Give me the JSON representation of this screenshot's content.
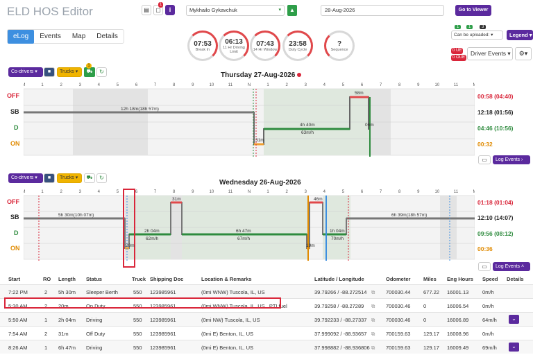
{
  "app": {
    "title": "ELD HOS Editor"
  },
  "header": {
    "driver": "Mykhailo Gykavchuk",
    "date": "28-Aug-2026",
    "go_viewer": "Go to Viewer",
    "doc_badge": "1"
  },
  "tabs": [
    "eLog",
    "Events",
    "Map",
    "Details"
  ],
  "gauges": [
    {
      "time": "07:53",
      "label": "Break In"
    },
    {
      "time": "06:13",
      "label": "11 Hr Driving Limit"
    },
    {
      "time": "07:43",
      "label": "14 Hr Window"
    },
    {
      "time": "23:58",
      "label": "Duty Cycle"
    },
    {
      "time": "?",
      "label": "Sequence"
    }
  ],
  "right_panel": {
    "count_badges": [
      "1",
      "1",
      "3"
    ],
    "can_be_uploaded": "Can be uploaded:",
    "legend": "Legend",
    "ue": "0 UE",
    "oue": "0 OUE",
    "driver_events": "Driver Events"
  },
  "log1": {
    "date": "Thursday 27-Aug-2026",
    "codrivers": "Co-drivers",
    "trucks": "Trucks",
    "truck_badge": "1",
    "hours": [
      "M",
      "1",
      "2",
      "3",
      "4",
      "5",
      "6",
      "7",
      "8",
      "9",
      "10",
      "11",
      "N",
      "1",
      "2",
      "3",
      "4",
      "5",
      "6",
      "7",
      "8",
      "9",
      "10",
      "11",
      "M"
    ],
    "row_labels": [
      "OFF",
      "SB",
      "D",
      "ON"
    ],
    "totals": [
      "00:58 (04:40)",
      "12:18 (01:56)",
      "04:46 (10:56)",
      "00:32"
    ],
    "seg_labels": [
      "12h 18m(18h 57m)",
      "58m",
      "4h 40m",
      "63m/h",
      "06m",
      "31m"
    ],
    "log_events": "Log Events"
  },
  "log2": {
    "date": "Wednesday 26-Aug-2026",
    "codrivers": "Co-drivers",
    "trucks": "Trucks",
    "hours": [
      "M",
      "1",
      "2",
      "3",
      "4",
      "5",
      "6",
      "7",
      "8",
      "9",
      "10",
      "11",
      "N",
      "1",
      "2",
      "3",
      "4",
      "5",
      "6",
      "7",
      "8",
      "9",
      "10",
      "11",
      "M"
    ],
    "row_labels": [
      "OFF",
      "SB",
      "D",
      "ON"
    ],
    "totals": [
      "01:18 (01:04)",
      "12:10 (14:07)",
      "09:56 (08:12)",
      "00:36"
    ],
    "seg_labels": [
      "5h 30m(10h 07m)",
      "31m",
      "2h 04m",
      "62m/h",
      "6h 47m",
      "67m/h",
      "46m",
      "1h 04m",
      "70m/h",
      "6h 39m(18h 57m)",
      "20m",
      "19m"
    ],
    "log_events": "Log Events"
  },
  "table": {
    "headers": [
      "Start",
      "RO",
      "Length",
      "Status",
      "Truck",
      "Shipping Doc",
      "Location & Remarks",
      "Latitude / Longitude",
      "Odometer",
      "Miles",
      "Eng Hours",
      "Speed",
      "Details"
    ],
    "rows": [
      [
        "7:22 PM",
        "2",
        "5h 30m",
        "Sleeper Berth",
        "550",
        "123985961",
        "(0mi WNW) Tuscola, IL, US",
        "39.79266 / -88.272514",
        "700030.44",
        "677.22",
        "16001.13",
        "0m/h"
      ],
      [
        "5:30 AM",
        "2",
        "20m",
        "On Duty",
        "550",
        "123985961",
        "(0mi WNW) Tuscola, IL, US,. PTI fuel",
        "39.79258 / -88.27289",
        "700030.46",
        "0",
        "16006.54",
        "0m/h"
      ],
      [
        "5:50 AM",
        "1",
        "2h 04m",
        "Driving",
        "550",
        "123985961",
        "(0mi NW) Tuscola, IL, US",
        "39.792233 / -88.27337",
        "700030.46",
        "0",
        "16006.89",
        "64m/h"
      ],
      [
        "7:54 AM",
        "2",
        "31m",
        "Off Duty",
        "550",
        "123985961",
        "(0mi E) Benton, IL, US",
        "37.999092 / -88.93657",
        "700159.63",
        "129.17",
        "16008.96",
        "0m/h"
      ],
      [
        "8:26 AM",
        "1",
        "6h 47m",
        "Driving",
        "550",
        "123985961",
        "(0mi E) Benton, IL, US",
        "37.998882 / -88.936806",
        "700159.63",
        "129.17",
        "16009.49",
        "69m/h"
      ]
    ]
  },
  "colors": {
    "accent": "#5b2a9e",
    "off": "#d9263a",
    "d": "#2e8b3e",
    "on": "#e08a00",
    "sb": "#333333"
  }
}
